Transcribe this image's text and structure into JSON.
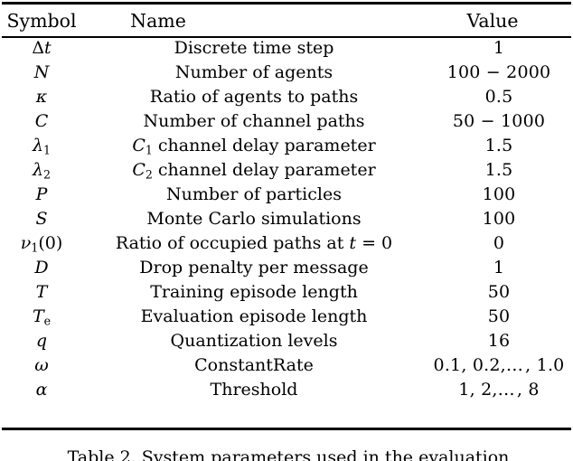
{
  "figure": {
    "kind": "table",
    "caption": "Table 2. System parameters used in the evaluation",
    "rule_color": "#000000",
    "background": "#ffffff"
  },
  "table": {
    "columns": [
      {
        "key": "symbol",
        "header": "Symbol"
      },
      {
        "key": "name",
        "header": "Name"
      },
      {
        "key": "value",
        "header": "Value"
      }
    ],
    "rows": [
      {
        "symbol": "Δt",
        "name": "Discrete time step",
        "value": "1"
      },
      {
        "symbol": "N",
        "name": "Number of agents",
        "value": "100 − 2000"
      },
      {
        "symbol": "κ",
        "name": "Ratio of agents to paths",
        "value": "0.5"
      },
      {
        "symbol": "C",
        "name": "Number of channel paths",
        "value": "50 − 1000"
      },
      {
        "symbol": "λ1",
        "name": "C1 channel delay parameter",
        "value": "1.5"
      },
      {
        "symbol": "λ2",
        "name": "C2 channel delay parameter",
        "value": "1.5"
      },
      {
        "symbol": "P",
        "name": "Number of particles",
        "value": "100"
      },
      {
        "symbol": "S",
        "name": "Monte Carlo simulations",
        "value": "100"
      },
      {
        "symbol": "ν1(0)",
        "name": "Ratio of occupied paths at t = 0",
        "value": "0"
      },
      {
        "symbol": "D",
        "name": "Drop penalty per message",
        "value": "1"
      },
      {
        "symbol": "T",
        "name": "Training episode length",
        "value": "50"
      },
      {
        "symbol": "Te",
        "name": "Evaluation episode length",
        "value": "50"
      },
      {
        "symbol": "q",
        "name": "Quantization levels",
        "value": "16"
      },
      {
        "symbol": "ω",
        "name": "ConstantRate",
        "value": "0.1, 0.2, … , 1.0"
      },
      {
        "symbol": "α",
        "name": "Threshold",
        "value": "1, 2, … , 8"
      }
    ],
    "row_parts": {
      "r0": {
        "sym_a": "Δ",
        "sym_b": "t"
      },
      "r4": {
        "sym_base": "λ",
        "sym_sub": "1",
        "name_base": "C",
        "name_sub": "1",
        "name_rest": " channel delay parameter"
      },
      "r5": {
        "sym_base": "λ",
        "sym_sub": "2",
        "name_base": "C",
        "name_sub": "2",
        "name_rest": " channel delay parameter"
      },
      "r8": {
        "sym_base": "ν",
        "sym_sub": "1",
        "sym_rest": "(0)",
        "name_a": "Ratio of occupied paths at ",
        "name_t": "t",
        "name_b": " = 0"
      },
      "r11": {
        "sym_base": "T",
        "sym_sub": "e"
      },
      "r13": {
        "val_a": "0.1, 0.2,",
        "val_ell": "…",
        "val_b": ", 1.0"
      },
      "r14": {
        "val_a": "1, 2,",
        "val_ell": "…",
        "val_b": ", 8"
      }
    }
  }
}
